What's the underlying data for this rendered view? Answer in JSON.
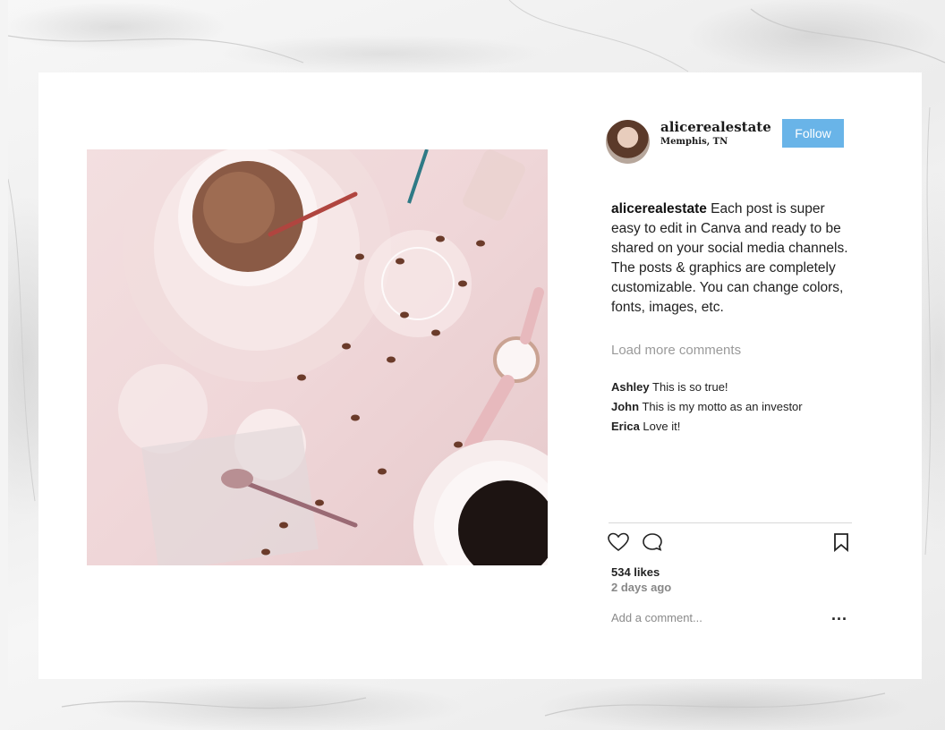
{
  "post": {
    "username": "alicerealestate",
    "location": "Memphis, TN",
    "follow_label": "Follow",
    "caption_user": "alicerealestate",
    "caption_text": " Each post is super easy to edit in Canva and ready to be shared on your social media channels. The posts & graphics are completely customizable. You can change colors, fonts, images, etc.",
    "load_more_label": "Load more comments",
    "comments": [
      {
        "user": "Ashley",
        "text": " This is so true!"
      },
      {
        "user": "John",
        "text": " This is my motto as an investor"
      },
      {
        "user": "Erica",
        "text": " Love it!"
      }
    ],
    "likes": "534 likes",
    "time_ago": "2 days ago",
    "comment_placeholder": "Add a comment...",
    "more_label": "..."
  },
  "icons": {
    "like": "heart-icon",
    "comment": "comment-bubble-icon",
    "save": "bookmark-icon",
    "more": "more-dots-icon"
  },
  "colors": {
    "follow_button": "#69b4e8",
    "photo_tint": "#efd6d8"
  }
}
